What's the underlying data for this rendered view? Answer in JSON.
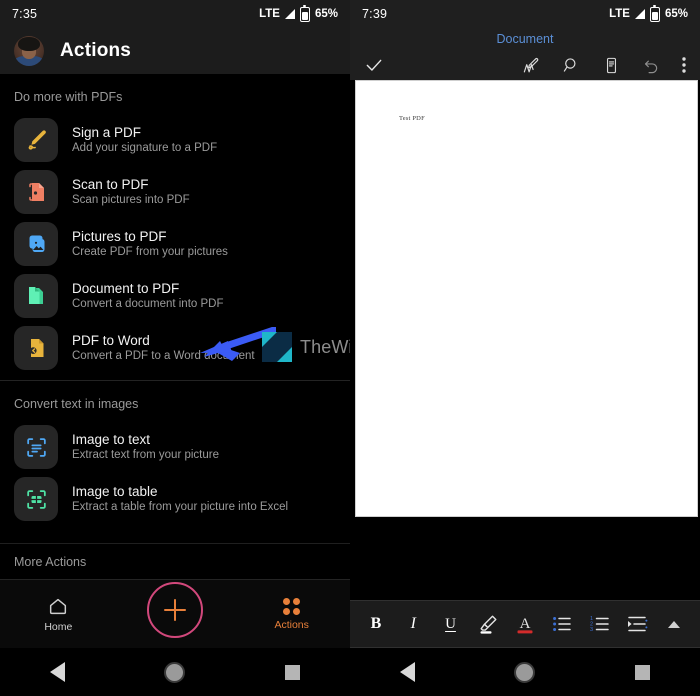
{
  "left_phone": {
    "status_bar": {
      "time": "7:35",
      "network": "LTE",
      "battery": "65%",
      "signal_icon": "signal-bars-icon",
      "battery_icon": "battery-icon"
    },
    "header": {
      "title": "Actions",
      "avatar": "user-avatar"
    },
    "sections": [
      {
        "label": "Do more with PDFs",
        "items": [
          {
            "title": "Sign a PDF",
            "subtitle": "Add your signature to a PDF",
            "icon": "pen-signature-icon",
            "color": "#e8b43c"
          },
          {
            "title": "Scan to PDF",
            "subtitle": "Scan pictures into PDF",
            "icon": "scan-document-icon",
            "color": "#ef7f63"
          },
          {
            "title": "Pictures to PDF",
            "subtitle": "Create PDF from your pictures",
            "icon": "picture-icon",
            "color": "#4fa8f5"
          },
          {
            "title": "Document to PDF",
            "subtitle": "Convert a document into PDF",
            "icon": "document-icon",
            "color": "#4fe3a5"
          },
          {
            "title": "PDF to Word",
            "subtitle": "Convert a PDF to a Word document",
            "icon": "pdf-to-word-icon",
            "color": "#e8b43c"
          }
        ]
      },
      {
        "label": "Convert text in images",
        "items": [
          {
            "title": "Image to text",
            "subtitle": "Extract text from your picture",
            "icon": "image-to-text-icon",
            "color": "#4fa8f5"
          },
          {
            "title": "Image to table",
            "subtitle": "Extract a table from your picture into Excel",
            "icon": "image-to-table-icon",
            "color": "#4fe3a5"
          }
        ]
      }
    ],
    "more_actions_label": "More Actions",
    "bottom_nav": {
      "home_label": "Home",
      "home_icon": "home-icon",
      "create_icon": "plus-icon",
      "actions_label": "Actions",
      "actions_icon": "grid-dots-icon",
      "accent_color": "#e8803a",
      "fab_ring_color": "#d2487c"
    },
    "system_nav": {
      "back": "back-triangle-icon",
      "home": "home-circle-icon",
      "recents": "recents-square-icon"
    },
    "annotation": {
      "arrow": "blue-arrow-pointing-left",
      "arrow_color": "#3b5bf5"
    },
    "watermark": {
      "text": "TheWindowsClub",
      "logo": "thewindowsclub-logo"
    }
  },
  "right_phone": {
    "status_bar": {
      "time": "7:39",
      "network": "LTE",
      "battery": "65%",
      "signal_icon": "signal-bars-icon",
      "battery_icon": "battery-icon"
    },
    "document_title": "Document",
    "toolbar": {
      "confirm_icon": "checkmark-icon",
      "items": [
        {
          "icon": "draw-pen-icon"
        },
        {
          "icon": "search-icon"
        },
        {
          "icon": "mobile-view-icon"
        },
        {
          "icon": "undo-icon"
        },
        {
          "icon": "overflow-menu-icon"
        }
      ]
    },
    "page": {
      "body_text": "Test PDF"
    },
    "format_bar": {
      "buttons": [
        {
          "label": "B",
          "name": "bold-button"
        },
        {
          "label": "I",
          "name": "italic-button"
        },
        {
          "label": "U",
          "name": "underline-button"
        },
        {
          "label": "",
          "name": "highlight-icon"
        },
        {
          "label": "A",
          "name": "font-color-icon"
        },
        {
          "label": "",
          "name": "bullet-list-icon"
        },
        {
          "label": "",
          "name": "numbered-list-icon"
        },
        {
          "label": "",
          "name": "indent-icon"
        },
        {
          "label": "",
          "name": "collapse-chevron-icon"
        }
      ],
      "highlight_color": "#ffffff",
      "font_color": "#d32b2b",
      "list_marker_color": "#3b6fd4"
    },
    "system_nav": {
      "back": "back-triangle-icon",
      "home": "home-circle-icon",
      "recents": "recents-square-icon"
    }
  }
}
